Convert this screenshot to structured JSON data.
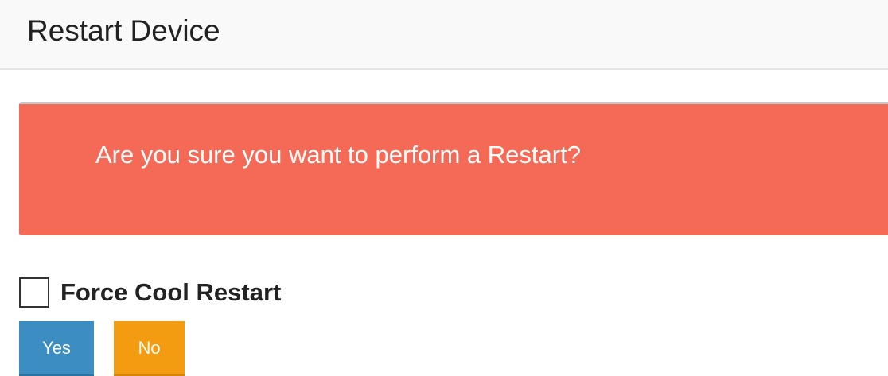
{
  "header": {
    "title": "Restart Device"
  },
  "alert": {
    "message": "Are you sure you want to perform a Restart?",
    "background_color": "#f56a56"
  },
  "options": {
    "force_cool_restart": {
      "label": "Force Cool Restart",
      "checked": false
    }
  },
  "actions": {
    "yes_label": "Yes",
    "no_label": "No",
    "yes_color": "#3c8dc1",
    "no_color": "#f39c12"
  }
}
